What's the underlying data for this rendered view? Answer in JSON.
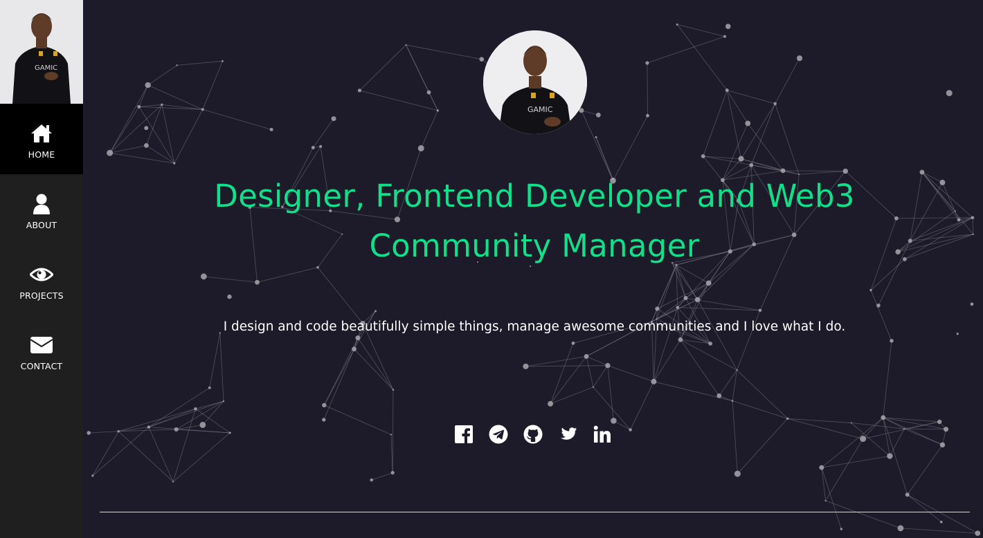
{
  "sidebar": {
    "photo_icon": "portrait-photo",
    "items": [
      {
        "label": "HOME",
        "icon": "home-icon",
        "active": true
      },
      {
        "label": "ABOUT",
        "icon": "user-icon",
        "active": false
      },
      {
        "label": "PROJECTS",
        "icon": "eye-icon",
        "active": false
      },
      {
        "label": "CONTACT",
        "icon": "envelope-icon",
        "active": false
      }
    ]
  },
  "hero": {
    "avatar_icon": "portrait-photo",
    "headline_line1": "Designer, Frontend Developer and Web3",
    "headline_line2": "Community Manager",
    "tagline": "I design and code beautifully simple things, manage awesome communities and I love what I do."
  },
  "social": [
    {
      "name": "Facebook",
      "icon": "facebook-icon"
    },
    {
      "name": "Telegram",
      "icon": "telegram-icon"
    },
    {
      "name": "GitHub",
      "icon": "github-icon"
    },
    {
      "name": "Twitter",
      "icon": "twitter-icon"
    },
    {
      "name": "LinkedIn",
      "icon": "linkedin-icon"
    }
  ],
  "colors": {
    "background": "#1d1b29",
    "sidebar": "#1f1f1f",
    "sidebar_active": "#000000",
    "accent": "#10e089",
    "text": "#ffffff"
  }
}
